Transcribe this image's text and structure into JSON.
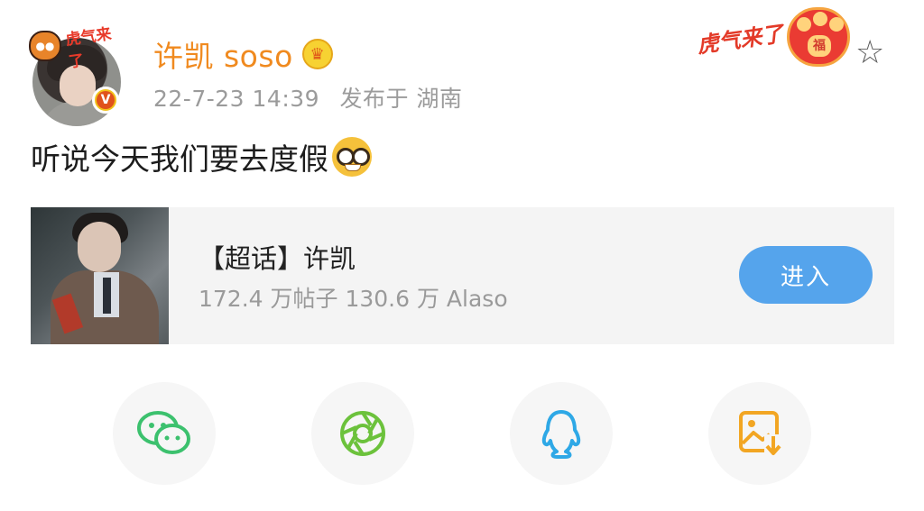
{
  "post": {
    "username": "许凯 soso",
    "date": "22-7-23 14:39",
    "location": "发布于 湖南",
    "content": "听说今天我们要去度假",
    "content_emoji": "nerd-face-emoji",
    "avatar_badge": "虎气来了",
    "verified_mark": "V",
    "header_decoration_text": "虎气来了",
    "header_decoration_badge": "福"
  },
  "topic_card": {
    "title": "【超话】许凯",
    "stats": "172.4 万帖子 130.6 万 Alaso",
    "enter_label": "进入"
  },
  "share_buttons": [
    {
      "icon": "wechat-icon",
      "color": "#3cc16e"
    },
    {
      "icon": "moments-icon",
      "color": "#6cc23c"
    },
    {
      "icon": "qq-icon",
      "color": "#2ea8e6"
    },
    {
      "icon": "save-image-icon",
      "color": "#f2a623"
    }
  ],
  "colors": {
    "username": "#f08a1f",
    "meta": "#9b9b9b",
    "enter_button": "#55a4ec",
    "card_background": "#f4f4f4"
  }
}
